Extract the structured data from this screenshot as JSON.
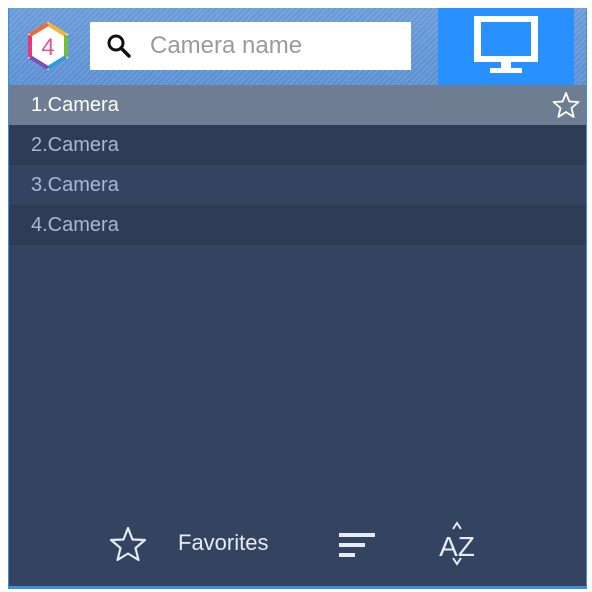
{
  "logo": {
    "digit": "4"
  },
  "search": {
    "placeholder": "Camera name",
    "value": ""
  },
  "cameras": [
    {
      "label": "1.Camera",
      "selected": true
    },
    {
      "label": "2.Camera",
      "selected": false
    },
    {
      "label": "3.Camera",
      "selected": false
    },
    {
      "label": "4.Camera",
      "selected": false
    }
  ],
  "bottom": {
    "favorites_label": "Favorites",
    "az_label": "AZ"
  },
  "colors": {
    "panel": "#344360",
    "selected_row": "#6f7d93",
    "accent": "#2891ff",
    "topbar": "#6d9fdd"
  }
}
